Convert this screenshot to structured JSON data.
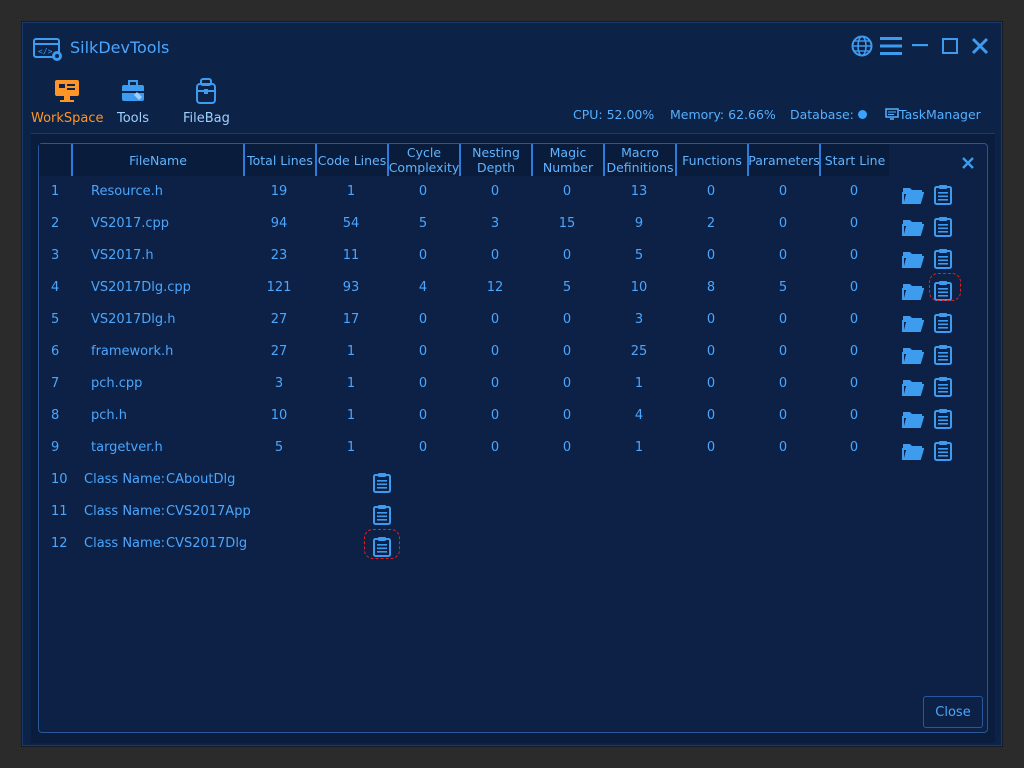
{
  "app": {
    "title": "SilkDevTools"
  },
  "colors": {
    "background": "#0d2247",
    "accent": "#3d9bf0",
    "active_nav": "#ff9526",
    "highlight": "#e02020"
  },
  "nav": [
    {
      "label": "WorkSpace",
      "icon": "monitor-icon",
      "active": true
    },
    {
      "label": "Tools",
      "icon": "toolbox-icon",
      "active": false
    },
    {
      "label": "FileBag",
      "icon": "bag-icon",
      "active": false
    }
  ],
  "status": {
    "cpu": "CPU: 52.00%",
    "memory": "Memory: 62.66%",
    "database": "Database:",
    "task_manager": "TaskManager"
  },
  "table": {
    "columns": [
      {
        "key": "index",
        "label": ""
      },
      {
        "key": "filename",
        "label": "FileName"
      },
      {
        "key": "total_lines",
        "label": "Total Lines"
      },
      {
        "key": "code_lines",
        "label": "Code Lines"
      },
      {
        "key": "cycle_complexity",
        "label": "Cycle\nComplexity"
      },
      {
        "key": "nesting_depth",
        "label": "Nesting\nDepth"
      },
      {
        "key": "magic_number",
        "label": "Magic\nNumber"
      },
      {
        "key": "macro_definitions",
        "label": "Macro\nDefinitions"
      },
      {
        "key": "functions",
        "label": "Functions"
      },
      {
        "key": "parameters",
        "label": "Parameters"
      },
      {
        "key": "start_line",
        "label": "Start Line"
      }
    ],
    "rows": [
      {
        "index": "1",
        "filename": "Resource.h",
        "total_lines": "19",
        "code_lines": "1",
        "cycle_complexity": "0",
        "nesting_depth": "0",
        "magic_number": "0",
        "macro_definitions": "13",
        "functions": "0",
        "parameters": "0",
        "start_line": "0"
      },
      {
        "index": "2",
        "filename": "VS2017.cpp",
        "total_lines": "94",
        "code_lines": "54",
        "cycle_complexity": "5",
        "nesting_depth": "3",
        "magic_number": "15",
        "macro_definitions": "9",
        "functions": "2",
        "parameters": "0",
        "start_line": "0"
      },
      {
        "index": "3",
        "filename": "VS2017.h",
        "total_lines": "23",
        "code_lines": "11",
        "cycle_complexity": "0",
        "nesting_depth": "0",
        "magic_number": "0",
        "macro_definitions": "5",
        "functions": "0",
        "parameters": "0",
        "start_line": "0"
      },
      {
        "index": "4",
        "filename": "VS2017Dlg.cpp",
        "total_lines": "121",
        "code_lines": "93",
        "cycle_complexity": "4",
        "nesting_depth": "12",
        "magic_number": "5",
        "macro_definitions": "10",
        "functions": "8",
        "parameters": "5",
        "start_line": "0",
        "highlighted": true
      },
      {
        "index": "5",
        "filename": "VS2017Dlg.h",
        "total_lines": "27",
        "code_lines": "17",
        "cycle_complexity": "0",
        "nesting_depth": "0",
        "magic_number": "0",
        "macro_definitions": "3",
        "functions": "0",
        "parameters": "0",
        "start_line": "0"
      },
      {
        "index": "6",
        "filename": "framework.h",
        "total_lines": "27",
        "code_lines": "1",
        "cycle_complexity": "0",
        "nesting_depth": "0",
        "magic_number": "0",
        "macro_definitions": "25",
        "functions": "0",
        "parameters": "0",
        "start_line": "0"
      },
      {
        "index": "7",
        "filename": "pch.cpp",
        "total_lines": "3",
        "code_lines": "1",
        "cycle_complexity": "0",
        "nesting_depth": "0",
        "magic_number": "0",
        "macro_definitions": "1",
        "functions": "0",
        "parameters": "0",
        "start_line": "0"
      },
      {
        "index": "8",
        "filename": "pch.h",
        "total_lines": "10",
        "code_lines": "1",
        "cycle_complexity": "0",
        "nesting_depth": "0",
        "magic_number": "0",
        "macro_definitions": "4",
        "functions": "0",
        "parameters": "0",
        "start_line": "0"
      },
      {
        "index": "9",
        "filename": "targetver.h",
        "total_lines": "5",
        "code_lines": "1",
        "cycle_complexity": "0",
        "nesting_depth": "0",
        "magic_number": "0",
        "macro_definitions": "1",
        "functions": "0",
        "parameters": "0",
        "start_line": "0"
      }
    ],
    "class_rows": [
      {
        "index": "10",
        "label": "Class Name:",
        "name": "CAboutDlg"
      },
      {
        "index": "11",
        "label": "Class Name:",
        "name": "CVS2017App"
      },
      {
        "index": "12",
        "label": "Class Name:",
        "name": "CVS2017Dlg",
        "highlighted": true
      }
    ],
    "row_icons": [
      "open-folder-icon",
      "clipboard-icon"
    ]
  },
  "dialog": {
    "close_label": "Close"
  }
}
